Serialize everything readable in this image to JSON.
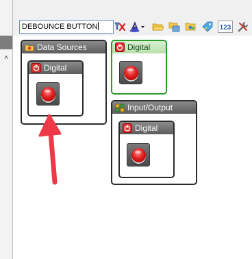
{
  "toolbar": {
    "search_value": "DEBOUNCE BUTTON",
    "icons": [
      "clear-filter-icon",
      "wizard-hat-icon",
      "folder-open-icon",
      "folder-copy-icon",
      "folder-group-icon",
      "tag-icon",
      "numbers-123-icon",
      "tools-icon"
    ],
    "numbers_label": "123"
  },
  "blocks": {
    "data_sources": {
      "title": "Data Sources",
      "child": {
        "title": "Digital"
      }
    },
    "digital_standalone": {
      "title": "Digital"
    },
    "input_output": {
      "title": "Input/Output",
      "child": {
        "title": "Digital"
      }
    }
  },
  "scroll": {
    "up_symbol": "˄",
    "down_symbol": "˅"
  },
  "colors": {
    "accent_green": "#2d9a2d",
    "annotation_red": "#ee3a48",
    "button_red": "#e01e1e"
  }
}
